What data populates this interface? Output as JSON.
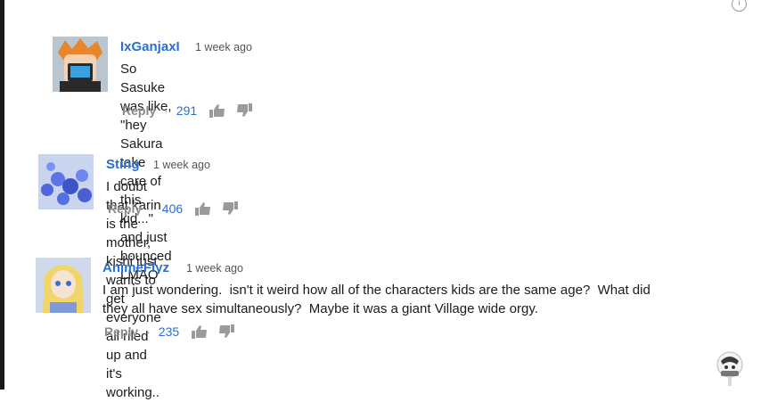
{
  "comments": [
    {
      "author": "IxGanjaxI",
      "time": "1 week ago",
      "lines": [
        "So Sasuke was like, \"hey Sakura take care of this kid...\"",
        "and just bounced LMAO"
      ],
      "reply_label": "Reply",
      "separator": "·",
      "likes": "291",
      "avatar_icon": "anime-boy-phone-avatar"
    },
    {
      "author": "Sting",
      "time": "1 week ago",
      "lines": [
        "I doubt that karin is the mother, kishi just wants to get everyone all riled up and it's working.."
      ],
      "reply_label": "Reply",
      "separator": "·",
      "likes": "406",
      "avatar_icon": "blue-flowers-avatar"
    },
    {
      "author": "AnimeFlyz",
      "time": "1 week ago",
      "lines": [
        "I am just wondering.  isn't it weird how all of the characters kids are the same age?  What did",
        "they all have sex simultaneously?  Maybe it was a giant Village wide orgy."
      ],
      "reply_label": "Reply",
      "separator": "·",
      "likes": "235",
      "avatar_icon": "anime-girl-avatar"
    }
  ],
  "colors": {
    "author": "#2a6fd1",
    "likes": "#2a6fd1",
    "reply": "#8a8a8a",
    "text": "#1b1b1b"
  }
}
